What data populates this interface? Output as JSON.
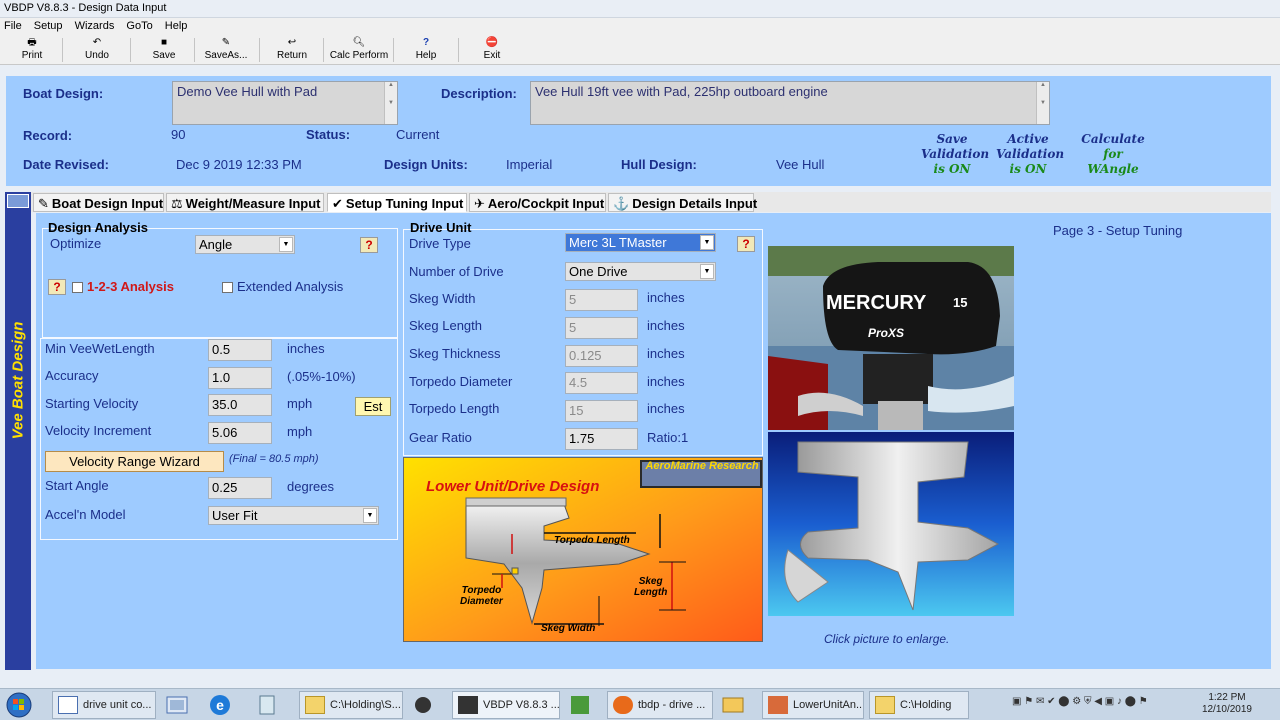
{
  "window": {
    "title": "VBDP V8.8.3 - Design Data Input"
  },
  "menu": [
    "File",
    "Setup",
    "Wizards",
    "GoTo",
    "Help"
  ],
  "toolbar": {
    "print": "Print",
    "undo": "Undo",
    "save": "Save",
    "saveas": "SaveAs...",
    "return": "Return",
    "calc": "Calc Perform",
    "help": "Help",
    "exit": "Exit"
  },
  "header": {
    "boat_design_label": "Boat Design:",
    "boat_design_value": "Demo Vee Hull with Pad",
    "description_label": "Description:",
    "description_value": "Vee Hull 19ft vee with Pad, 225hp outboard engine",
    "record_label": "Record:",
    "record_value": "90",
    "status_label": "Status:",
    "status_value": "Current",
    "date_label": "Date Revised:",
    "date_value": "Dec 9 2019 12:33 PM",
    "units_label": "Design Units:",
    "units_value": "Imperial",
    "hull_label": "Hull Design:",
    "hull_value": "Vee Hull",
    "save_validation": [
      "Save",
      "Validation",
      "is ON"
    ],
    "active_validation": [
      "Active",
      "Validation",
      "is ON"
    ],
    "calculate": [
      "Calculate",
      "for",
      "WAngle"
    ]
  },
  "side_title": "Vee Boat Design",
  "tabs": [
    {
      "label": "Boat Design Input",
      "icon": "✎"
    },
    {
      "label": "Weight/Measure Input",
      "icon": "⚖"
    },
    {
      "label": "Setup Tuning Input",
      "icon": "✔"
    },
    {
      "label": "Aero/Cockpit Input",
      "icon": "✈"
    },
    {
      "label": "Design Details Input",
      "icon": "⚓"
    }
  ],
  "page_label": "Page 3 - Setup Tuning",
  "analysis": {
    "title": "Design Analysis",
    "optimize_label": "Optimize",
    "optimize_value": "Angle",
    "analysis_123": "1-2-3 Analysis",
    "extended": "Extended Analysis",
    "rows": [
      {
        "label": "Min VeeWetLength",
        "value": "0.5",
        "unit": "inches"
      },
      {
        "label": "Accuracy",
        "value": "1.0",
        "unit": "(.05%-10%)"
      },
      {
        "label": "Starting Velocity",
        "value": "35.0",
        "unit": "mph"
      },
      {
        "label": "Velocity Increment",
        "value": "5.06",
        "unit": "mph"
      }
    ],
    "est_label": "Est",
    "wizard_label": "Velocity Range Wizard",
    "final_note": "(Final = 80.5 mph)",
    "start_angle_label": "Start Angle",
    "start_angle_value": "0.25",
    "start_angle_unit": "degrees",
    "accel_label": "Accel'n Model",
    "accel_value": "User Fit"
  },
  "drive": {
    "title": "Drive Unit",
    "type_label": "Drive Type",
    "type_value": "Merc 3L TMaster",
    "number_label": "Number of Drive",
    "number_value": "One Drive",
    "rows": [
      {
        "label": "Skeg Width",
        "value": "5",
        "unit": "inches"
      },
      {
        "label": "Skeg Length",
        "value": "5",
        "unit": "inches"
      },
      {
        "label": "Skeg Thickness",
        "value": "0.125",
        "unit": "inches"
      },
      {
        "label": "Torpedo Diameter",
        "value": "4.5",
        "unit": "inches"
      },
      {
        "label": "Torpedo Length",
        "value": "15",
        "unit": "inches"
      }
    ],
    "gear_label": "Gear Ratio",
    "gear_value": "1.75",
    "gear_unit": "Ratio:1"
  },
  "diagram": {
    "title": "Lower Unit/Drive Design",
    "brand": "AeroMarine Research",
    "torpedo_length": "Torpedo Length",
    "torpedo_diameter": [
      "Torpedo",
      "Diameter"
    ],
    "skeg_length": [
      "Skeg",
      "Length"
    ],
    "skeg_width": "Skeg Width"
  },
  "photo": {
    "brand": "MERCURY",
    "model": "ProXS",
    "number": "15",
    "caption": "Click picture to enlarge."
  },
  "taskbar": {
    "items": [
      "drive unit co...",
      "C:\\Holding\\S...",
      "VBDP V8.8.3 ...",
      "tbdp - drive ...",
      "LowerUnitAn...",
      "C:\\Holding"
    ],
    "time": "1:22 PM",
    "date": "12/10/2019"
  }
}
